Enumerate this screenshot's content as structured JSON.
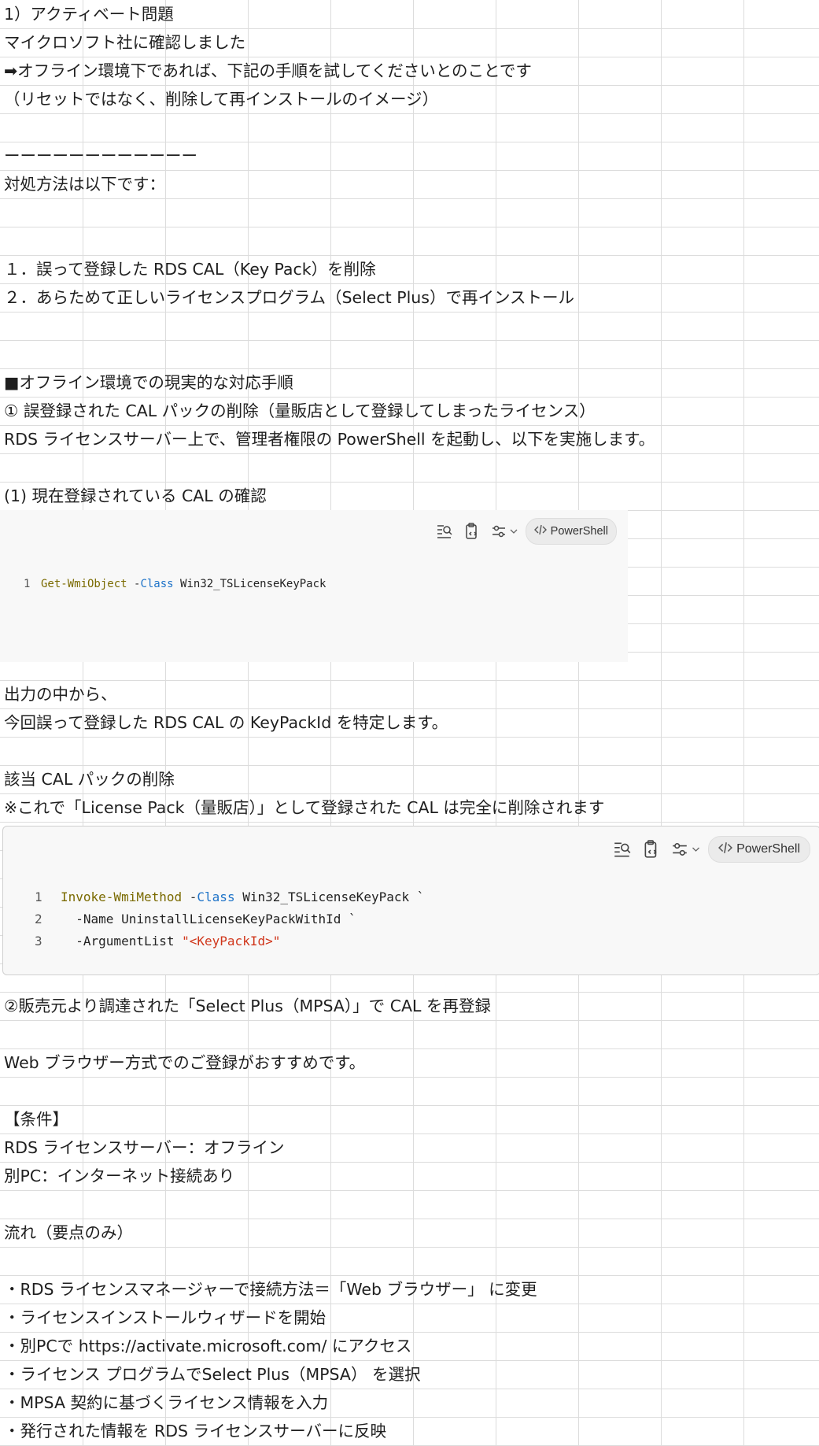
{
  "rows": [
    {
      "text": "1）アクティベート問題"
    },
    {
      "text": "マイクロソフト社に確認しました"
    },
    {
      "text": "➡オフライン環境下であれば、下記の手順を試してくださいとのことです"
    },
    {
      "text": "（リセットではなく、削除して再インストールのイメージ）"
    },
    {
      "text": ""
    },
    {
      "text": "ーーーーーーーーーーーー"
    },
    {
      "text": "対処方法は以下です："
    },
    {
      "text": ""
    },
    {
      "text": ""
    },
    {
      "text": "１．誤って登録した RDS CAL（Key Pack）を削除"
    },
    {
      "text": "２．あらためて正しいライセンスプログラム（Select Plus）で再インストール"
    },
    {
      "text": ""
    },
    {
      "text": ""
    },
    {
      "text": "■オフライン環境での現実的な対応手順"
    },
    {
      "text": "① 誤登録された CAL パックの削除（量販店として登録してしまったライセンス）"
    },
    {
      "text": "RDS ライセンスサーバー上で、管理者権限の PowerShell を起動し、以下を実施します。"
    },
    {
      "text": ""
    },
    {
      "text": "(1) 現在登録されている CAL の確認"
    },
    {
      "text": ""
    },
    {
      "text": ""
    },
    {
      "text": ""
    },
    {
      "text": ""
    },
    {
      "text": ""
    },
    {
      "text": ""
    },
    {
      "text": "出力の中から、"
    },
    {
      "text": "今回誤って登録した RDS CAL の KeyPackId を特定します。"
    },
    {
      "text": ""
    },
    {
      "text": "該当 CAL パックの削除"
    },
    {
      "text": "※これで「License Pack（量販店）」として登録された CAL は完全に削除されます"
    },
    {
      "text": ""
    },
    {
      "text": ""
    },
    {
      "text": ""
    },
    {
      "text": ""
    },
    {
      "text": ""
    },
    {
      "text": ""
    },
    {
      "text": "②販売元より調達された「Select Plus（MPSA）」で CAL を再登録"
    },
    {
      "text": ""
    },
    {
      "text": "Web ブラウザー方式でのご登録がおすすめです。"
    },
    {
      "text": ""
    },
    {
      "text": "【条件】"
    },
    {
      "text": "RDS ライセンスサーバー：オフライン"
    },
    {
      "text": "別PC：インターネット接続あり"
    },
    {
      "text": ""
    },
    {
      "text": "流れ（要点のみ）"
    },
    {
      "text": ""
    },
    {
      "text": "・RDS ライセンスマネージャーで接続方法＝「Web ブラウザー」 に変更"
    },
    {
      "text": "・ライセンスインストールウィザードを開始"
    },
    {
      "text": "・別PCで https://activate.microsoft.com/ にアクセス"
    },
    {
      "text": "・ライセンス プログラムでSelect Plus（MPSA） を選択"
    },
    {
      "text": "・MPSA 契約に基づくライセンス情報を入力"
    },
    {
      "text": "・発行された情報を RDS ライセンスサーバーに反映"
    }
  ],
  "code_block_1": {
    "language": "PowerShell",
    "lines": [
      {
        "num": "1",
        "cmd": "Get-WmiObject",
        "sp1": " ",
        "op": "-",
        "kw": "Class",
        "rest": " Win32_TSLicenseKeyPack",
        "str": ""
      }
    ]
  },
  "code_block_2": {
    "language": "PowerShell",
    "lines": [
      {
        "num": "1",
        "cmd": "Invoke-WmiMethod",
        "sp1": " ",
        "op": "-",
        "kw": "Class",
        "rest": " Win32_TSLicenseKeyPack `",
        "str": ""
      },
      {
        "num": "2",
        "cmd": "",
        "sp1": "  ",
        "op": "",
        "kw": "",
        "rest": "-Name UninstallLicenseKeyPackWithId `",
        "str": ""
      },
      {
        "num": "3",
        "cmd": "",
        "sp1": "  ",
        "op": "",
        "kw": "",
        "rest": "-ArgumentList ",
        "str": "\"<KeyPackId>\""
      }
    ]
  },
  "toolbar_icons": [
    "search-in-code-icon",
    "copy-code-icon",
    "options-icon",
    "chevron-down-icon",
    "code-brackets-icon"
  ],
  "colors": {
    "grid": "#dcdcdc",
    "code_bg": "#f8f8f8",
    "cmdlet": "#7a6a00",
    "keyword": "#1e73c8",
    "string": "#d0361b"
  }
}
